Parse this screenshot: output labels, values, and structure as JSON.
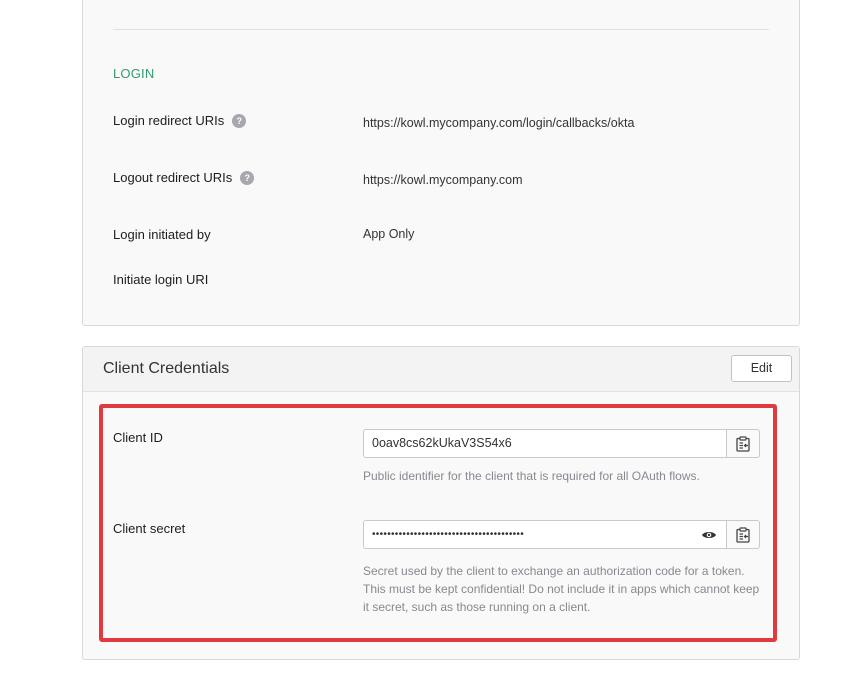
{
  "login": {
    "section_title": "LOGIN",
    "rows": [
      {
        "label": "Login redirect URIs",
        "value": "https://kowl.mycompany.com/login/callbacks/okta"
      },
      {
        "label": "Logout redirect URIs",
        "value": "https://kowl.mycompany.com"
      },
      {
        "label": "Login initiated by",
        "value": "App Only"
      },
      {
        "label": "Initiate login URI",
        "value": ""
      }
    ],
    "help_glyph": "?"
  },
  "credentials": {
    "title": "Client Credentials",
    "edit_label": "Edit",
    "client_id": {
      "label": "Client ID",
      "value": "0oav8cs62kUkaV3S54x6",
      "hint": "Public identifier for the client that is required for all OAuth flows."
    },
    "client_secret": {
      "label": "Client secret",
      "value": "••••••••••••••••••••••••••••••••••••••••",
      "hint": "Secret used by the client to exchange an authorization code for a token. This must be kept confidential! Do not include it in apps which cannot keep it secret, such as those running on a client."
    }
  },
  "icons": {
    "help": "help-circle-icon",
    "copy": "clipboard-copy-icon",
    "reveal": "eye-icon"
  },
  "colors": {
    "section_title": "#2e9e6e",
    "highlight_border": "#e0393e",
    "help_bg": "#a7a7ad"
  }
}
